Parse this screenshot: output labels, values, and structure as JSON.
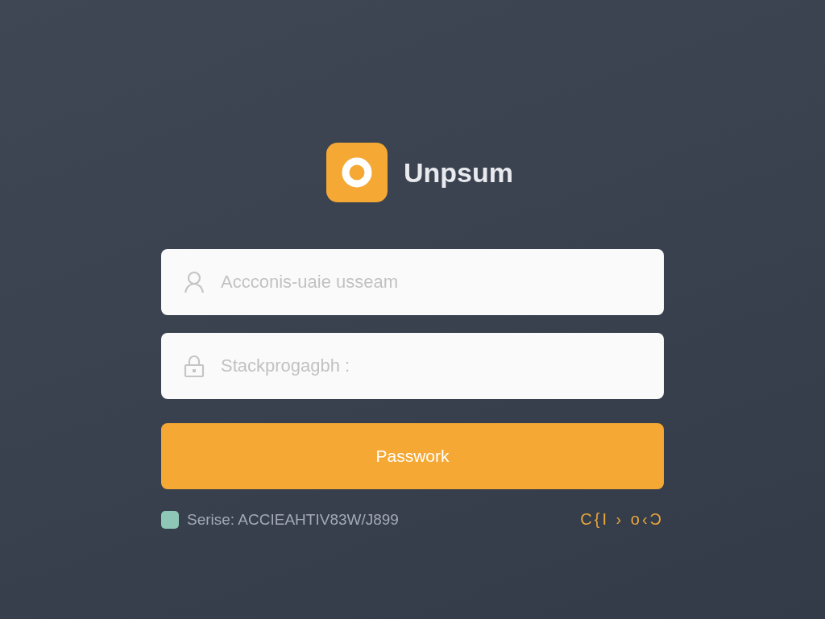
{
  "brand": {
    "name": "Unpsum"
  },
  "fields": [
    {
      "kind": "user",
      "placeholder": "Accconis-uaie usseam"
    },
    {
      "kind": "lock",
      "placeholder": "Stackprogagbh :"
    }
  ],
  "submit": {
    "label": "Passwork"
  },
  "footer": {
    "serial": "Serise: ACCIEAHTIV83W/J899",
    "code": "C{I › o‹Ͻ"
  }
}
